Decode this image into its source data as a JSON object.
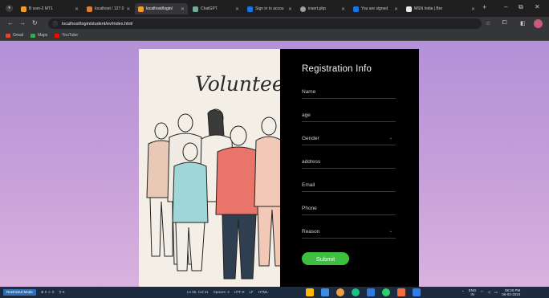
{
  "browser": {
    "tabs": [
      {
        "label": "B ssm-2 MT1",
        "favicon_color": "#f29b30",
        "active": false
      },
      {
        "label": "localhost / 127.0",
        "favicon_color": "#e07b39",
        "active": false
      },
      {
        "label": "localhost/login/",
        "favicon_color": "#f29b30",
        "active": true
      },
      {
        "label": "ChatGPT",
        "favicon_color": "#74aa9c",
        "active": false
      },
      {
        "label": "Sign in to accou",
        "favicon_color": "#1a73e8",
        "active": false
      },
      {
        "label": "insert.php",
        "favicon_color": "#9aa0a6",
        "active": false
      },
      {
        "label": "You are signed",
        "favicon_color": "#1a73e8",
        "active": false
      },
      {
        "label": "MSN India | Bre",
        "favicon_color": "#e8eaed",
        "active": false
      }
    ],
    "url": "localhost/login/student/ev/index.html",
    "bookmarks": [
      {
        "label": "Gmail",
        "icon": "gmail-icon",
        "color": "#ea4335"
      },
      {
        "label": "Maps",
        "icon": "maps-icon",
        "color": "#34a853"
      },
      {
        "label": "YouTube",
        "icon": "youtube-icon",
        "color": "#ff0000"
      }
    ]
  },
  "page": {
    "illustration_title": "Volunteers",
    "form": {
      "title": "Registration Info",
      "fields": {
        "name": "Name",
        "age": "age",
        "gender": "Gender",
        "address": "address",
        "email": "Email",
        "phone": "Phone",
        "reason": "Reason"
      },
      "submit_label": "Submit"
    },
    "colors": {
      "background_top": "#b391d8",
      "background_bottom": "#d8b3de",
      "form_panel": "#000000",
      "submit": "#3fbf3f"
    }
  },
  "taskbar": {
    "restricted_mode": "Restricted Mode",
    "problems": "⊗ 0 ⚠ 0",
    "ports": "⚲ 0",
    "cursor_pos": "Ln 55, Col 41",
    "spaces": "Spaces: 4",
    "encoding": "UTF-8",
    "eol": "LF",
    "language": "HTML",
    "lang_top": "ENG",
    "lang_bottom": "IN",
    "time": "08:20 PM",
    "date": "06-02-2024"
  }
}
